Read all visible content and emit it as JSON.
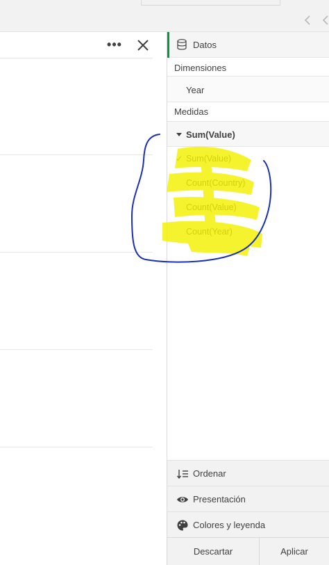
{
  "chart_toolbar": {
    "more_label": "•••"
  },
  "properties": {
    "data_tab": "Datos",
    "dimensions_label": "Dimensiones",
    "dimension_item": "Year",
    "measures_label": "Medidas",
    "measure_selected": "Sum(Value)",
    "measure_options": [
      {
        "label": "Sum(Value)",
        "checked": true,
        "check": "✓"
      },
      {
        "label": "Count(Country)",
        "checked": false
      },
      {
        "label": "Count(Value)",
        "checked": false
      },
      {
        "label": "Count(Year)",
        "checked": false
      }
    ],
    "sort_label": "Ordenar",
    "presentation_label": "Presentación",
    "colors_label": "Colores y leyenda",
    "discard_label": "Descartar",
    "apply_label": "Aplicar"
  },
  "colors": {
    "accent_green": "#009845",
    "highlight_yellow": "#f4f100",
    "annotation_blue": "#1b2fb5"
  },
  "icons": [
    "chevron-left-icon",
    "chevron-right-icon",
    "more-icon",
    "close-icon",
    "database-icon",
    "sort-icon",
    "eye-icon",
    "palette-icon"
  ]
}
